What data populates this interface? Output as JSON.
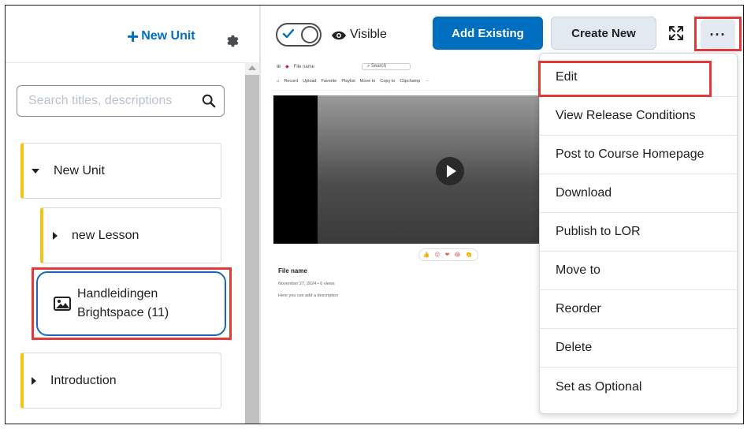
{
  "left_panel": {
    "new_unit_label": "New Unit",
    "search": {
      "placeholder": "Search titles, descriptions"
    },
    "tree": {
      "unit": "New Unit",
      "lesson": "new Lesson",
      "handleidingen_line1": "Handleidingen",
      "handleidingen_line2": "Brightspace (11)",
      "introduction": "Introduction"
    }
  },
  "toolbar": {
    "visible_label": "Visible",
    "add_existing": "Add Existing",
    "create_new": "Create New",
    "more": "···"
  },
  "preview": {
    "file_name_top": "File name",
    "search": "Search",
    "tools": [
      "Record",
      "Upload",
      "Favorite",
      "Playlist",
      "Move to",
      "Copy to",
      "Clipchamp",
      "···"
    ],
    "title": "File name",
    "date": "November 27, 2024  •  0 views",
    "description": "Here you can add a description",
    "reactions": "👍 😮 ❤ 😂 👏"
  },
  "menu": {
    "items": [
      "Edit",
      "View Release Conditions",
      "Post to Course Homepage",
      "Download",
      "Publish to LOR",
      "Move to",
      "Reorder",
      "Delete",
      "Set as Optional"
    ]
  },
  "colors": {
    "accent": "#006fbf",
    "unit_bar": "#f3c316",
    "highlight": "#e23a3a",
    "selection": "#1967b7"
  }
}
